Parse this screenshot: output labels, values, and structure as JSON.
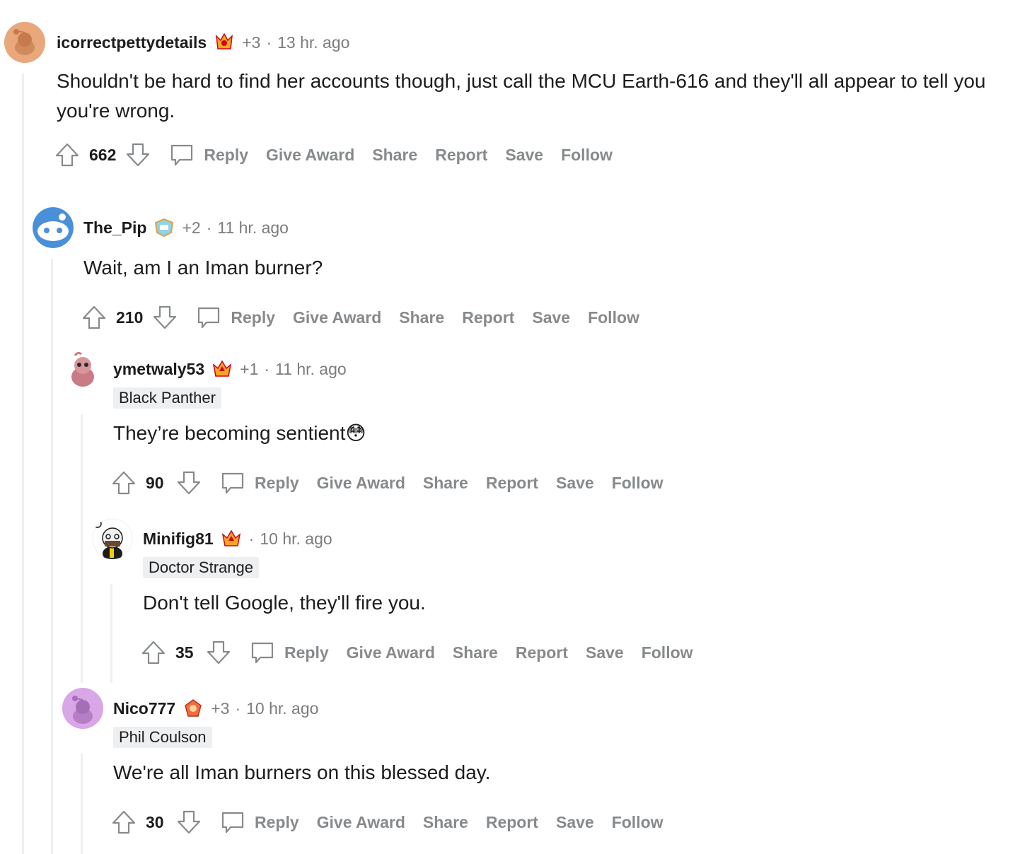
{
  "comments": [
    {
      "username": "icorrectpettydetails",
      "karma": "+3",
      "time": "13 hr. ago",
      "flair": "",
      "body": "Shouldn't be hard to find her accounts though, just call the MCU Earth-616 and they'll all appear to tell you you're wrong.",
      "score": "662",
      "avatar_color": "#e8a87c"
    },
    {
      "username": "The_Pip",
      "karma": "+2",
      "time": "11 hr. ago",
      "flair": "",
      "body": "Wait, am I an Iman burner?",
      "score": "210",
      "avatar_color": "#4a90d9"
    },
    {
      "username": "ymetwaly53",
      "karma": "+1",
      "time": "11 hr. ago",
      "flair": "Black Panther",
      "body": "They’re becoming sentient😳",
      "score": "90",
      "avatar_color": "#c97c85"
    },
    {
      "username": "Minifig81",
      "karma": "",
      "time": "10 hr. ago",
      "flair": "Doctor Strange",
      "body": "Don't tell Google, they'll fire you.",
      "score": "35",
      "avatar_color": "#ffffff"
    },
    {
      "username": "Nico777",
      "karma": "+3",
      "time": "10 hr. ago",
      "flair": "Phil Coulson",
      "body": "We're all Iman burners on this blessed day.",
      "score": "30",
      "avatar_color": "#d9a6e8"
    }
  ],
  "actions": {
    "reply": "Reply",
    "give_award": "Give Award",
    "share": "Share",
    "report": "Report",
    "save": "Save",
    "follow": "Follow"
  },
  "icons": {
    "upvote": "upvote-icon",
    "downvote": "downvote-icon",
    "reply": "comment-bubble-icon"
  },
  "colors": {
    "text": "#1c1c1c",
    "meta": "#7c7c7c",
    "action": "#878a8c",
    "thread_line": "#edeff1",
    "flair_bg": "#edeff1"
  }
}
